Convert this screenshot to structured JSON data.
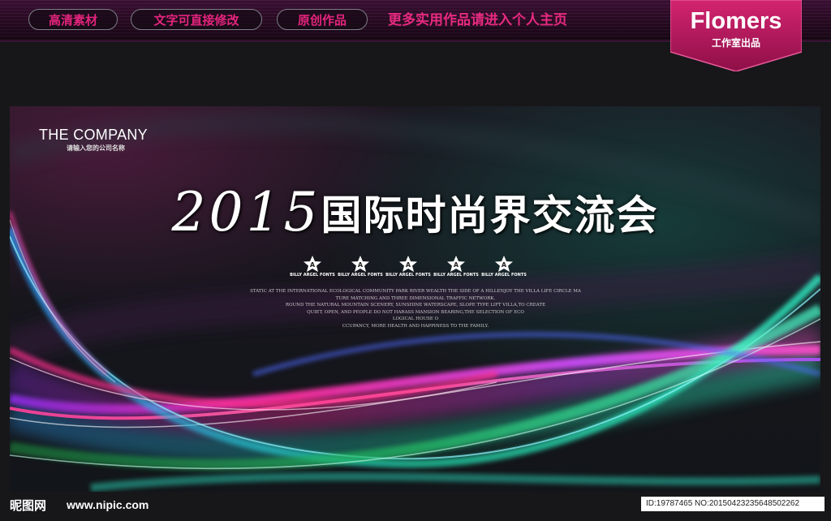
{
  "topbar": {
    "pills": [
      "高清素材",
      "文字可直接修改",
      "原创作品"
    ],
    "promo": "更多实用作品请进入个人主页"
  },
  "badge": {
    "brand": "Flomers",
    "subtitle": "工作室出品"
  },
  "poster": {
    "company": "THE COMPANY",
    "company_sub": "请输入您的公司名称",
    "year": "2015",
    "title": "国际时尚界交流会",
    "star_letter": "A",
    "star_caption": "BILLY ARGEL FONTS",
    "blurb": [
      "STATIC AT THE INTERNATIONAL ECOLOGICAL COMMUNITY PARK RIVER WEALTH THE SIDE OF A HILLENJOY THE VILLA LIFE CIRCLE MA",
      "TURE MATCHING AND THREE DIMENSIONAL TRAFFIC NETWORK.",
      "ROUND THE NATURAL MOUNTAIN SCENERY, SUNSHINE WATERSCAPE, SLOPE TYPE LIFT VILLA,TO CREATE",
      "QUIET, OPEN, AND PEOPLE DO NOT HARASS MANSION BEARING,THE SELECTION OF ECO",
      "LOGICAL HOUSE O",
      "CCUPANCY, MORE HEALTH AND HAPPINESS TO THE FAMILY."
    ]
  },
  "watermark": {
    "logo": "昵图网",
    "site": "www.nipic.com",
    "id_text": "ID:19787465 NO:20150423235648502262"
  },
  "colors": {
    "accent_pink": "#e4247d",
    "badge_magenta": "#b5195f"
  }
}
